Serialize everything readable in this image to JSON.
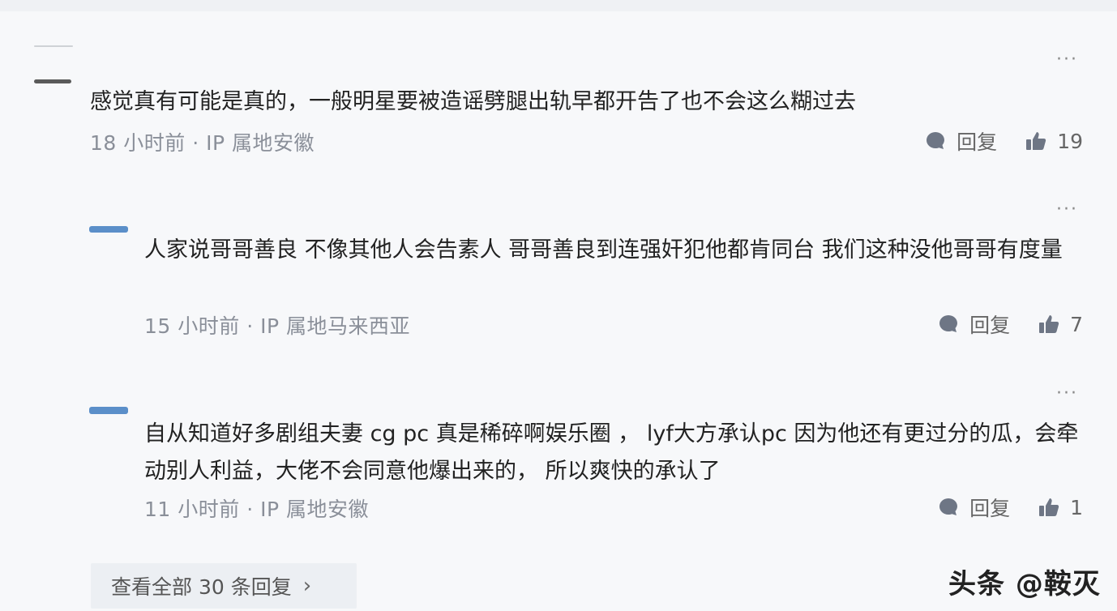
{
  "comments": [
    {
      "text": "感觉真有可能是真的，一般明星要被造谣劈腿出轨早都开告了也不会这么糊过去",
      "meta": "18 小时前 · IP 属地安徽",
      "reply_label": "回复",
      "likes": "19",
      "more": "···"
    },
    {
      "text": "人家说哥哥善良 不像其他人会告素人 哥哥善良到连强奸犯他都肯同台 我们这种没他哥哥有度量",
      "meta": "15 小时前 · IP 属地马来西亚",
      "reply_label": "回复",
      "likes": "7",
      "more": "···"
    },
    {
      "text": "自从知道好多剧组夫妻 cg pc 真是稀碎啊娱乐圈 ， lyf大方承认pc 因为他还有更过分的瓜，会牵动别人利益，大佬不会同意他爆出来的， 所以爽快的承认了",
      "meta": "11 小时前 · IP 属地安徽",
      "reply_label": "回复",
      "likes": "1",
      "more": "···"
    }
  ],
  "view_all": {
    "label": "查看全部 30 条回复",
    "chevron": "›"
  },
  "watermark": "头条 @鞍灭",
  "icons": {
    "reply": "comment-bubble-icon",
    "like": "thumbs-up-icon",
    "more": "more-dots-icon"
  },
  "colors": {
    "avatar_blue": "#5b8fc9",
    "meta_gray": "#8a8f99",
    "icon_gray": "#6e7685"
  }
}
